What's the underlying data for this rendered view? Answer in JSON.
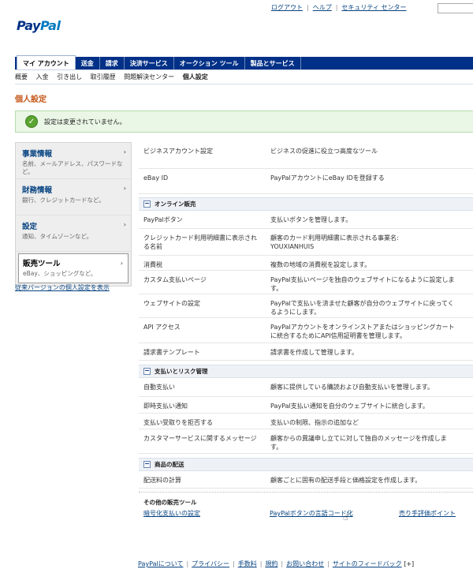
{
  "header": {
    "links": [
      "ログアウト",
      "ヘルプ",
      "セキュリティ センター"
    ],
    "logo_pay": "Pay",
    "logo_pal": "Pal"
  },
  "tabs": [
    "マイ アカウント",
    "送金",
    "請求",
    "決済サービス",
    "オークション ツール",
    "製品とサービス"
  ],
  "subtabs": [
    "概要",
    "入金",
    "引き出し",
    "取引履歴",
    "問題解決センター",
    "個人設定"
  ],
  "page_title": "個人設定",
  "notice": "設定は変更されていません。",
  "sidebar": {
    "items": [
      {
        "title": "事業情報",
        "desc": "名前、メールアドレス、パスワードなど。"
      },
      {
        "title": "財務情報",
        "desc": "銀行、クレジットカードなど。"
      },
      {
        "title": "設定",
        "desc": "通知、タイムゾーンなど。"
      },
      {
        "title": "販売ツール",
        "desc": "eBay、ショッピングなど。"
      }
    ],
    "legacy_link": "従来バージョンの個人設定を表示"
  },
  "rows_top": [
    {
      "label": "ビジネスアカウント設定",
      "value": "ビジネスの促進に役立つ高度なツール"
    },
    {
      "label": "eBay ID",
      "value": "PayPalアカウントにeBay IDを登録する"
    }
  ],
  "section_online": {
    "title": "オンライン販売",
    "rows": [
      {
        "label": "PayPalボタン",
        "value": "支払いボタンを管理します。"
      },
      {
        "label": "クレジットカード利用明細書に表示される名前",
        "value": "顧客のカード利用明細書に表示される事業名:\nYOUXIANHUIS"
      },
      {
        "label": "消費税",
        "value": "複数の地域の消費税を設定します。"
      },
      {
        "label": "カスタム支払いページ",
        "value": "PayPal支払いページを独自のウェブサイトになるように設定します。"
      },
      {
        "label": "ウェブサイトの設定",
        "value": "PayPalで支払いを済ませた顧客が自分のウェブサイトに戻ってくるようにします。"
      },
      {
        "label": "API アクセス",
        "value": "PayPalアカウントをオンラインストアまたはショッピングカートに統合するためにAPI信用証明書を管理します。"
      },
      {
        "label": "請求書テンプレート",
        "value": "請求書を作成して管理します。"
      }
    ]
  },
  "section_risk": {
    "title": "支払いとリスク管理",
    "rows": [
      {
        "label": "自動支払い",
        "value": "顧客に提供している購読および自動支払いを管理します。"
      },
      {
        "label": "即時支払い通知",
        "value": "PayPal支払い通知を自分のウェブサイトに統合します。"
      },
      {
        "label": "支払い受取りを拒否する",
        "value": "支払いの制限、指示の追加など"
      },
      {
        "label": "カスタマーサービスに関するメッセージ",
        "value": "顧客からの異議申し立てに対して独自のメッセージを作成します。"
      }
    ]
  },
  "section_ship": {
    "title": "商品の配送",
    "rows": [
      {
        "label": "配送料の計算",
        "value": "顧客ごとに固有の配送手段と価格設定を作成します。"
      }
    ]
  },
  "other_tools": {
    "title": "その他の販売ツール",
    "links": [
      "暗号化支払いの設定",
      "PayPalボタンの言語コード化",
      "売り手評価ポイント"
    ]
  },
  "footer": [
    "PayPalについて",
    "プライバシー",
    "手数料",
    "規約",
    "お問い合わせ",
    "サイトのフィードバック",
    "[+]"
  ]
}
